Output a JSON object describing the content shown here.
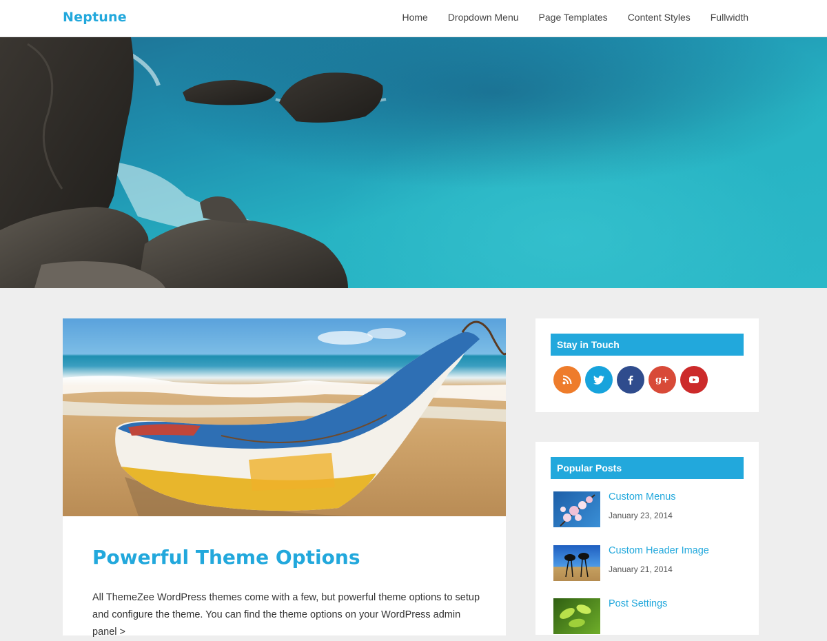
{
  "site": {
    "title": "Neptune"
  },
  "nav": {
    "items": [
      "Home",
      "Dropdown Menu",
      "Page Templates",
      "Content Styles",
      "Fullwidth"
    ]
  },
  "post": {
    "title": "Powerful Theme Options",
    "excerpt_line1": "All ThemeZee WordPress themes come with a few, but powerful theme options to setup",
    "excerpt_line2": "and configure the theme. You can find the theme options on your WordPress admin panel >"
  },
  "widgets": {
    "stay_in_touch": {
      "title": "Stay in Touch",
      "icons": [
        {
          "name": "rss-icon",
          "color": "#ee7c2b"
        },
        {
          "name": "twitter-icon",
          "color": "#17a3dc"
        },
        {
          "name": "facebook-icon",
          "color": "#2f4c8d"
        },
        {
          "name": "google-plus-icon",
          "color": "#d84a38"
        },
        {
          "name": "youtube-icon",
          "color": "#cc2a2a"
        }
      ]
    },
    "popular_posts": {
      "title": "Popular Posts",
      "items": [
        {
          "title": "Custom Menus",
          "date": "January 23, 2014"
        },
        {
          "title": "Custom Header Image",
          "date": "January 21, 2014"
        },
        {
          "title": "Post Settings",
          "date": ""
        }
      ]
    }
  },
  "colors": {
    "accent": "#22a8dc",
    "background": "#eeeeee"
  }
}
